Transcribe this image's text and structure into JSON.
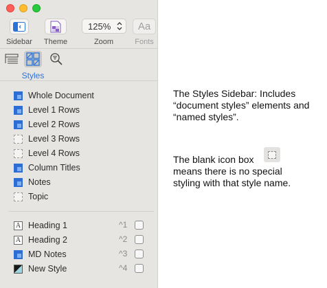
{
  "toolbar": {
    "sidebar_label": "Sidebar",
    "theme_label": "Theme",
    "zoom_value": "125%",
    "zoom_label": "Zoom",
    "fonts_glyph": "Aa",
    "fonts_label": "Fonts"
  },
  "inspector": {
    "active_tab_label": "Styles"
  },
  "document_styles": [
    {
      "label": "Whole Document",
      "swatch": "blue"
    },
    {
      "label": "Level 1 Rows",
      "swatch": "blue"
    },
    {
      "label": "Level 2 Rows",
      "swatch": "blue"
    },
    {
      "label": "Level 3 Rows",
      "swatch": "blank"
    },
    {
      "label": "Level 4 Rows",
      "swatch": "blank"
    },
    {
      "label": "Column Titles",
      "swatch": "blue"
    },
    {
      "label": "Notes",
      "swatch": "blue"
    },
    {
      "label": "Topic",
      "swatch": "blank"
    }
  ],
  "named_styles": [
    {
      "label": "Heading 1",
      "swatch_letter": "A",
      "shortcut": "^1"
    },
    {
      "label": "Heading 2",
      "swatch_letter": "A",
      "shortcut": "^2"
    },
    {
      "label": "MD Notes",
      "swatch": "blue",
      "shortcut": "^3"
    },
    {
      "label": "New Style",
      "swatch": "diag",
      "shortcut": "^4"
    }
  ],
  "explanation": {
    "para1": "The Styles Sidebar: Includes “document styles” elements and “named styles”.",
    "para2_line1": "The blank icon box",
    "para2_rest": "means there is no special styling with that style name."
  },
  "colors": {
    "accent": "#2b73d6",
    "swatch_blue": "#2e6ed4",
    "sidebar_bg": "#e7e5e2"
  }
}
